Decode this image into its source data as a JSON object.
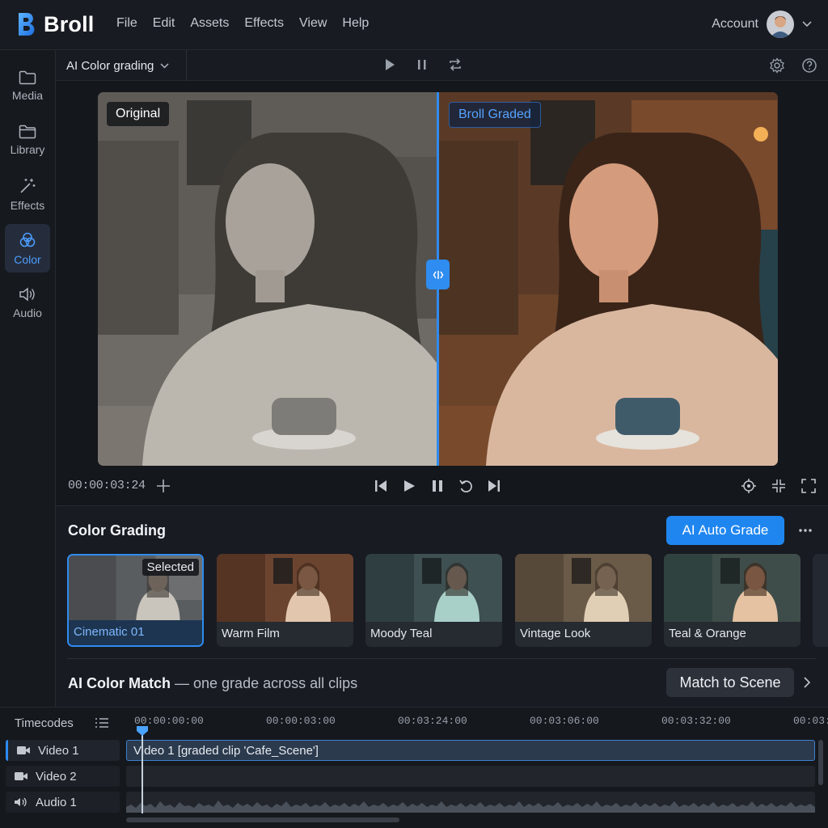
{
  "app": {
    "name": "Broll",
    "brand_color": "#2f8cf0"
  },
  "menu": {
    "items": [
      "File",
      "Edit",
      "Assets",
      "Effects",
      "View",
      "Help"
    ]
  },
  "account": {
    "label": "Account"
  },
  "sidebar": {
    "items": [
      {
        "label": "Media",
        "icon": "folder-icon"
      },
      {
        "label": "Library",
        "icon": "library-folder-icon"
      },
      {
        "label": "Effects",
        "icon": "magic-wand-icon"
      },
      {
        "label": "Color",
        "icon": "color-circles-icon",
        "active": true
      },
      {
        "label": "Audio",
        "icon": "speaker-icon"
      }
    ]
  },
  "viewer": {
    "mode": "AI Color grading",
    "tag_original": "Original",
    "tag_graded": "Broll Graded",
    "timecode": "00:00:03:24"
  },
  "color_grading": {
    "title": "Color Grading",
    "auto_grade_label": "AI Auto Grade",
    "selected_badge": "Selected",
    "presets": [
      {
        "label": "Cinematic 01",
        "selected": true
      },
      {
        "label": "Warm Film"
      },
      {
        "label": "Moody Teal"
      },
      {
        "label": "Vintage Look"
      },
      {
        "label": "Teal & Orange"
      }
    ],
    "match_title": "AI Color Match",
    "match_desc": " — one grade across all clips",
    "match_button": "Match to Scene"
  },
  "timeline": {
    "title": "Timecodes",
    "ruler": [
      "00:00:00:00",
      "00:00:03:00",
      "00:03:24:00",
      "00:03:06:00",
      "00:03:32:00",
      "00:03:"
    ],
    "tracks": [
      {
        "label": "Video 1",
        "icon": "video-camera-icon",
        "active": true
      },
      {
        "label": "Video 2",
        "icon": "video-camera-icon"
      },
      {
        "label": "Audio 1",
        "icon": "speaker-icon"
      }
    ],
    "clip_label": "Video 1 [graded clip 'Cafe_Scene']"
  }
}
